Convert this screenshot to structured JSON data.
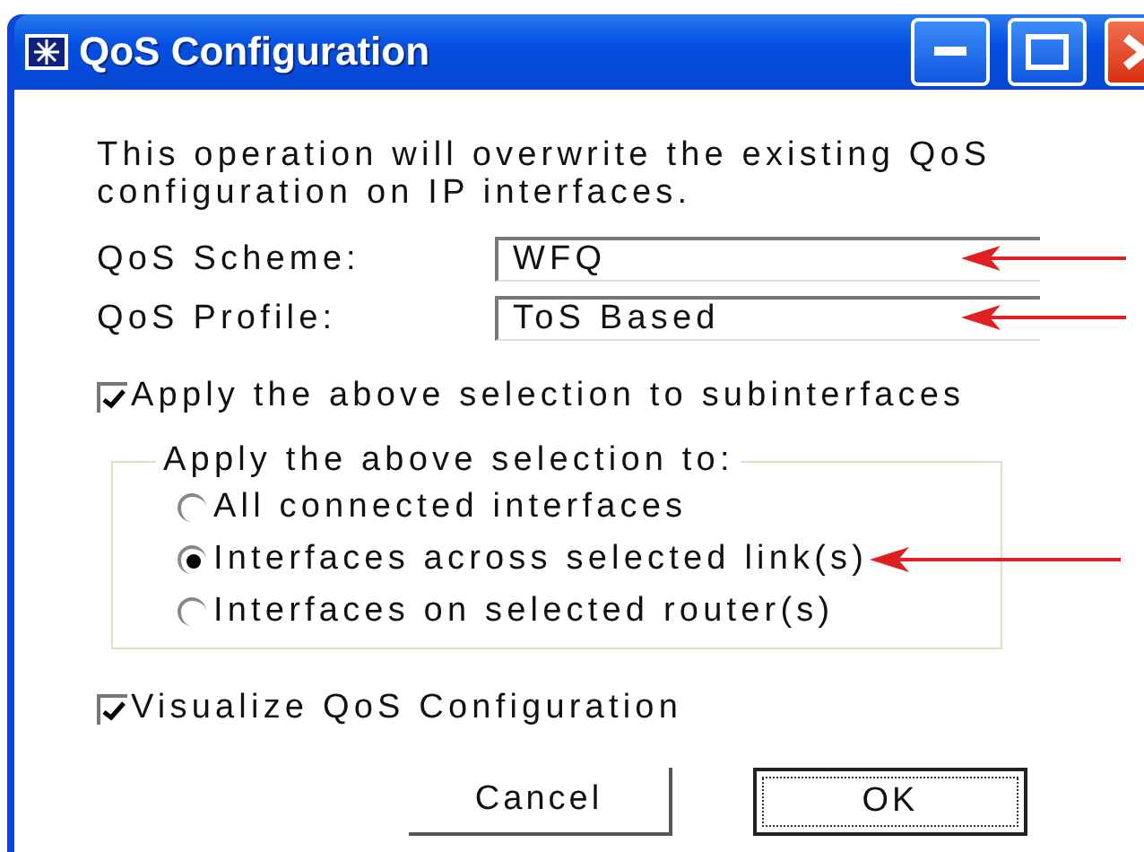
{
  "window": {
    "title": "QoS Configuration"
  },
  "message": "This operation will overwrite the existing QoS configuration on IP interfaces.",
  "fields": [
    {
      "label": "QoS Scheme:",
      "value": "WFQ",
      "annotated": true
    },
    {
      "label": "QoS Profile:",
      "value": "ToS Based",
      "annotated": true
    }
  ],
  "subinterfaces": {
    "label": "Apply the above selection to subinterfaces",
    "checked": true
  },
  "scope": {
    "title": "Apply the above selection to:",
    "options": [
      {
        "label": "All connected interfaces",
        "selected": false,
        "annotated": false
      },
      {
        "label": "Interfaces across selected link(s)",
        "selected": true,
        "annotated": true
      },
      {
        "label": "Interfaces on selected router(s)",
        "selected": false,
        "annotated": false
      }
    ]
  },
  "visualize": {
    "label": "Visualize QoS Configuration",
    "checked": true
  },
  "buttons": [
    {
      "label": "Cancel",
      "default": false
    },
    {
      "label": "OK",
      "default": true
    }
  ]
}
